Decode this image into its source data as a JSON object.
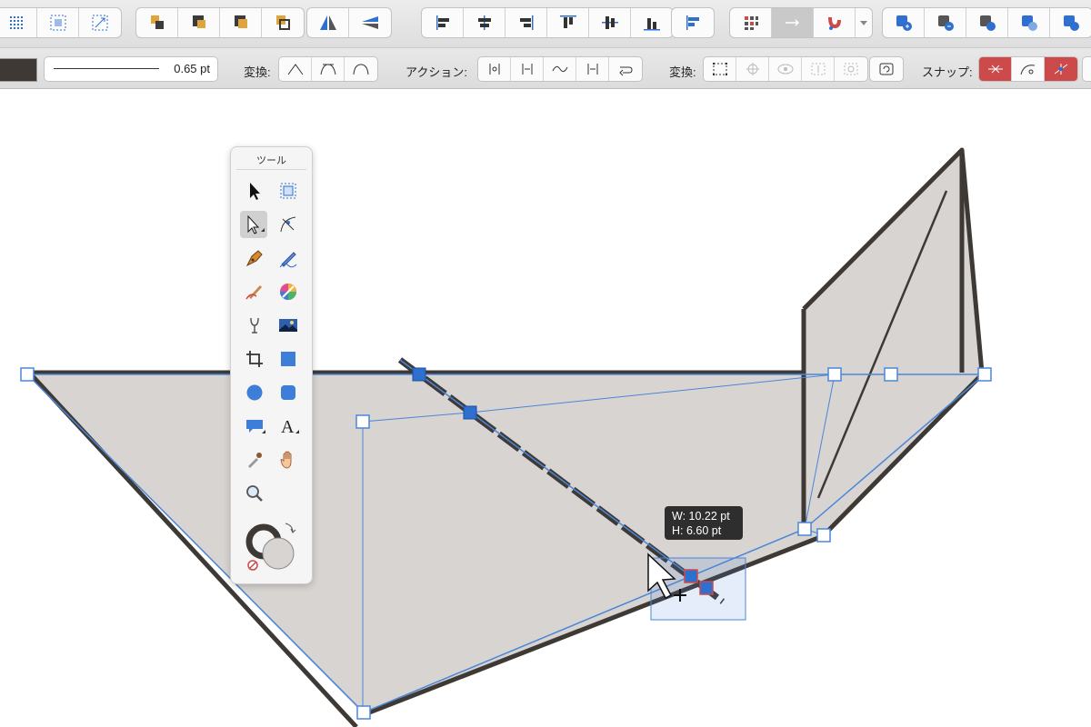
{
  "colors": {
    "fill": "#d8d4d2",
    "stroke": "#3e3934",
    "selection_blue": "#4a86d8",
    "snap_red": "#cc4a4a",
    "toolbar_bg": "#e4e4e4"
  },
  "toolbar_top": {
    "groups": [
      [
        "select-all-icon",
        "select-grid-icon",
        "transform-select-icon"
      ],
      [
        "arrange-back-icon",
        "arrange-backward-icon",
        "arrange-forward-icon",
        "arrange-front-icon"
      ],
      [
        "flip-horizontal-icon",
        "flip-vertical-icon"
      ],
      [
        "align-left-icon",
        "align-center-icon",
        "align-right-icon",
        "align-top-icon",
        "align-middle-icon",
        "align-bottom-icon"
      ],
      [
        "distribute-icon"
      ],
      [
        "snap-grid-icon",
        "snap-arrow-icon",
        "magnet-icon"
      ],
      [
        "boolean-add-icon",
        "boolean-subtract-icon",
        "boolean-intersect-icon",
        "boolean-xor-icon",
        "boolean-divide-icon"
      ]
    ]
  },
  "toolbar_context": {
    "stroke_width": "0.65 pt",
    "convert_label": "変換:",
    "action_label": "アクション:",
    "transform_label": "変換:",
    "snap_label": "スナップ:"
  },
  "tools_palette": {
    "title": "ツール",
    "tools": [
      "move-tool-icon",
      "artboard-tool-icon",
      "node-tool-icon",
      "corner-tool-icon",
      "pen-tool-icon",
      "pencil-tool-icon",
      "vector-brush-icon",
      "color-wheel-icon",
      "fill-tool-icon",
      "place-image-icon",
      "crop-tool-icon",
      "rectangle-tool-icon",
      "ellipse-tool-icon",
      "rounded-rect-tool-icon",
      "speech-bubble-tool-icon",
      "text-tool-icon",
      "color-picker-icon",
      "hand-tool-icon",
      "zoom-tool-icon"
    ],
    "selected_tool": "node-tool-icon"
  },
  "tooltip": {
    "width_text": "W: 10.22 pt",
    "height_text": "H: 6.60 pt"
  }
}
